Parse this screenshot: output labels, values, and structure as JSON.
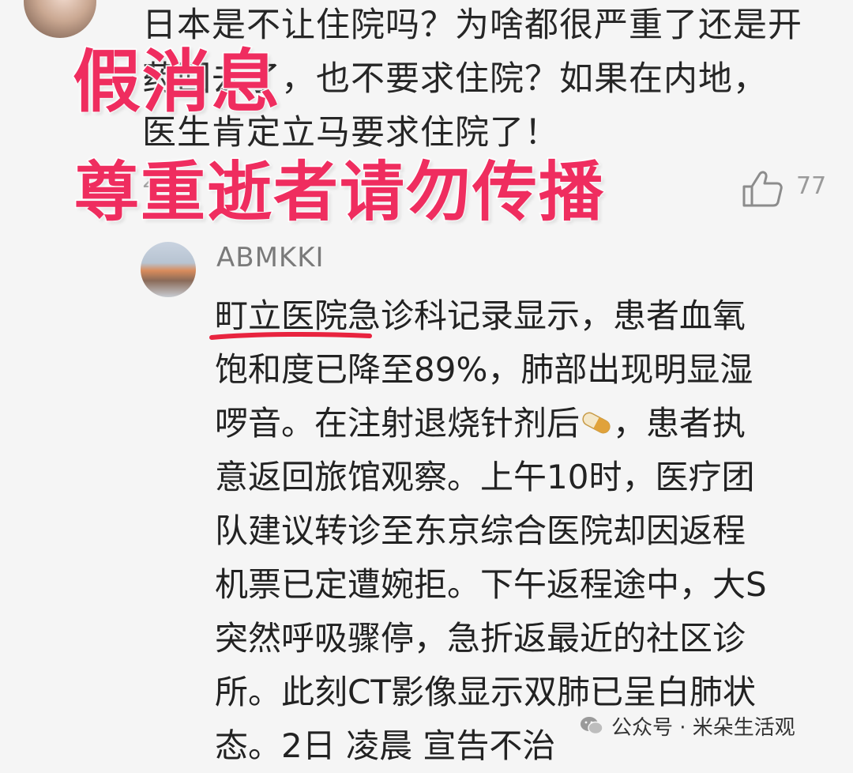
{
  "parent_comment": {
    "lines": [
      "日本是不让住院吗？为啥都很严重了还是开",
      "药回去了，也不要求住院？如果在内地，",
      "医生肯定立马要求住院了！"
    ],
    "meta": "2",
    "like_count": "77"
  },
  "overlay": {
    "line1": "假消息",
    "line2": "尊重逝者请勿传播",
    "color": "#ef2d5f"
  },
  "reply": {
    "username": "ABMKKI",
    "line1_highlight": "町立医院",
    "line1_rest": "急诊科记录显示，患者血氧",
    "line2": "饱和度已降至89%，肺部出现明显湿",
    "line3_pre": "啰音。在注射退烧针剂后",
    "line3_post": "，患者执",
    "line4": "意返回旅馆观察。上午10时，医疗团",
    "line5": "队建议转诊至东京综合医院却因返程",
    "line6": "机票已定遭婉拒。下午返程途中，大S",
    "line7": "突然呼吸骤停，急折返最近的社区诊",
    "line8": "所。此刻CT影像显示双肺已呈白肺状",
    "line9": "态。2日 凌晨 宣告不治",
    "pill_icon": "pill-icon"
  },
  "watermark": {
    "text": "公众号 · 米朵生活观",
    "icon": "wechat-icon"
  }
}
